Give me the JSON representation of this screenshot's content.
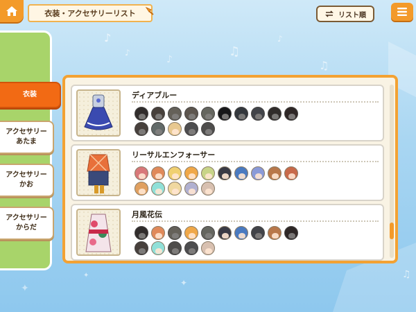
{
  "header": {
    "title": "衣装・アクセサリーリスト",
    "sort_label": "リスト順"
  },
  "sidebar": {
    "tabs": [
      {
        "line1": "衣装",
        "line2": "",
        "active": true
      },
      {
        "line1": "アクセサリー",
        "line2": "あたま",
        "active": false
      },
      {
        "line1": "アクセサリー",
        "line2": "かお",
        "active": false
      },
      {
        "line1": "アクセサリー",
        "line2": "からだ",
        "active": false
      }
    ]
  },
  "costumes": [
    {
      "name": "ディアブルー",
      "characters": [
        {
          "hair": "#7a4a3a",
          "owned": false
        },
        {
          "hair": "#c0682e",
          "owned": false
        },
        {
          "hair": "#d8b04a",
          "owned": false
        },
        {
          "hair": "#e8923a",
          "owned": false
        },
        {
          "hair": "#b8c06a",
          "owned": false
        },
        {
          "hair": "#2a2a34",
          "owned": false
        },
        {
          "hair": "#3a6aa8",
          "owned": false
        },
        {
          "hair": "#6a7ab8",
          "owned": false
        },
        {
          "hair": "#7a4a2a",
          "owned": false
        },
        {
          "hair": "#8a3a2a",
          "owned": false
        },
        {
          "hair": "#b86a3a",
          "owned": false
        },
        {
          "hair": "#7ad0c8",
          "owned": false
        },
        {
          "hair": "#e8c890",
          "owned": true
        },
        {
          "hair": "#8a8aa8",
          "owned": false
        },
        {
          "hair": "#9a8a7a",
          "owned": false
        }
      ]
    },
    {
      "name": "リーサルエンフォーサー",
      "characters": [
        {
          "hair": "#d8787a",
          "owned": true
        },
        {
          "hair": "#e08a5a",
          "owned": true
        },
        {
          "hair": "#f0d070",
          "owned": true
        },
        {
          "hair": "#f0a848",
          "owned": true
        },
        {
          "hair": "#c8d488",
          "owned": true
        },
        {
          "hair": "#3a3a44",
          "owned": true
        },
        {
          "hair": "#4a7ac0",
          "owned": true
        },
        {
          "hair": "#8a9ad8",
          "owned": true
        },
        {
          "hair": "#b8784a",
          "owned": true
        },
        {
          "hair": "#c86a4a",
          "owned": true
        },
        {
          "hair": "#e0a060",
          "owned": true
        },
        {
          "hair": "#90e0d8",
          "owned": true
        },
        {
          "hair": "#f0d8a0",
          "owned": true
        },
        {
          "hair": "#b0b0d0",
          "owned": true
        },
        {
          "hair": "#d8c0b0",
          "owned": true
        }
      ]
    },
    {
      "name": "月風花伝",
      "characters": [
        {
          "hair": "#7a4a3a",
          "owned": false
        },
        {
          "hair": "#e08a5a",
          "owned": true
        },
        {
          "hair": "#d8b04a",
          "owned": false
        },
        {
          "hair": "#f0a848",
          "owned": true
        },
        {
          "hair": "#b8c06a",
          "owned": false
        },
        {
          "hair": "#3a3a44",
          "owned": true
        },
        {
          "hair": "#4a7ac0",
          "owned": true
        },
        {
          "hair": "#6a7ab8",
          "owned": false
        },
        {
          "hair": "#b8784a",
          "owned": true
        },
        {
          "hair": "#8a3a2a",
          "owned": false
        },
        {
          "hair": "#b86a3a",
          "owned": false
        },
        {
          "hair": "#90e0d8",
          "owned": true
        },
        {
          "hair": "#9a8a6a",
          "owned": false
        },
        {
          "hair": "#8a8aa8",
          "owned": false
        },
        {
          "hair": "#d8c0b0",
          "owned": true
        }
      ]
    }
  ],
  "colors": {
    "accent": "#f39a2a",
    "active_tab": "#f26a14",
    "sidebar": "#a8d46a"
  },
  "scroll": {
    "position": 0.88
  }
}
